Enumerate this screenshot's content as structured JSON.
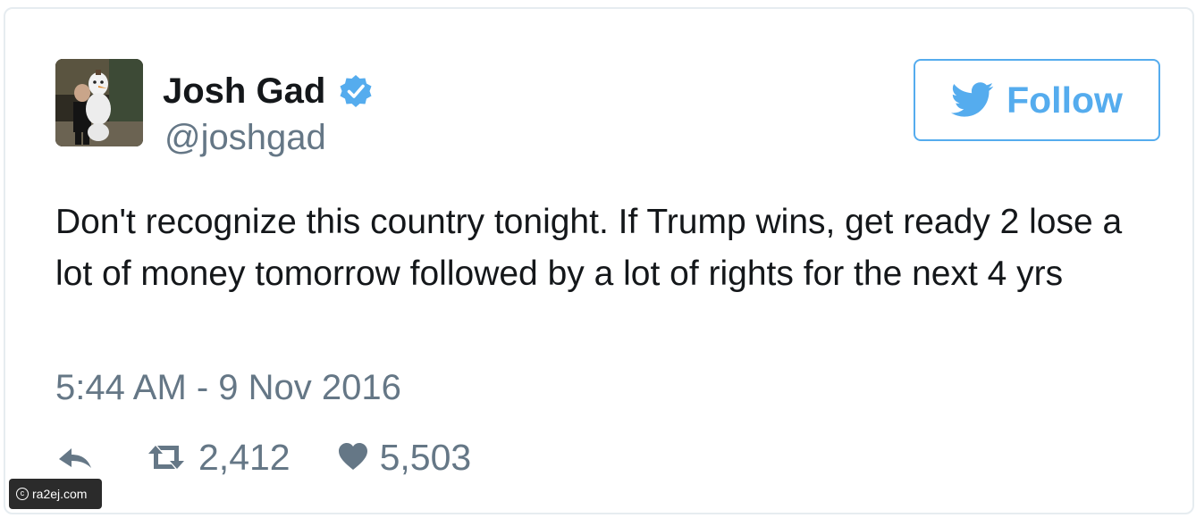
{
  "user": {
    "display_name": "Josh Gad",
    "handle": "@joshgad",
    "verified": true
  },
  "follow_button": {
    "label": "Follow",
    "icon": "twitter-bird-icon"
  },
  "tweet": {
    "text": "Don't recognize this country tonight. If Trump wins, get ready 2 lose a lot of money tomorrow followed by a lot of rights for the next 4 yrs",
    "timestamp": "5:44 AM - 9 Nov 2016"
  },
  "actions": {
    "reply_icon": "reply-icon",
    "retweet_icon": "retweet-icon",
    "retweet_count": "2,412",
    "like_icon": "heart-icon",
    "like_count": "5,503"
  },
  "watermark": {
    "text": "ra2ej.com"
  },
  "colors": {
    "accent": "#55acee",
    "text": "#14171a",
    "secondary": "#657786",
    "border": "#e6ecf0"
  }
}
